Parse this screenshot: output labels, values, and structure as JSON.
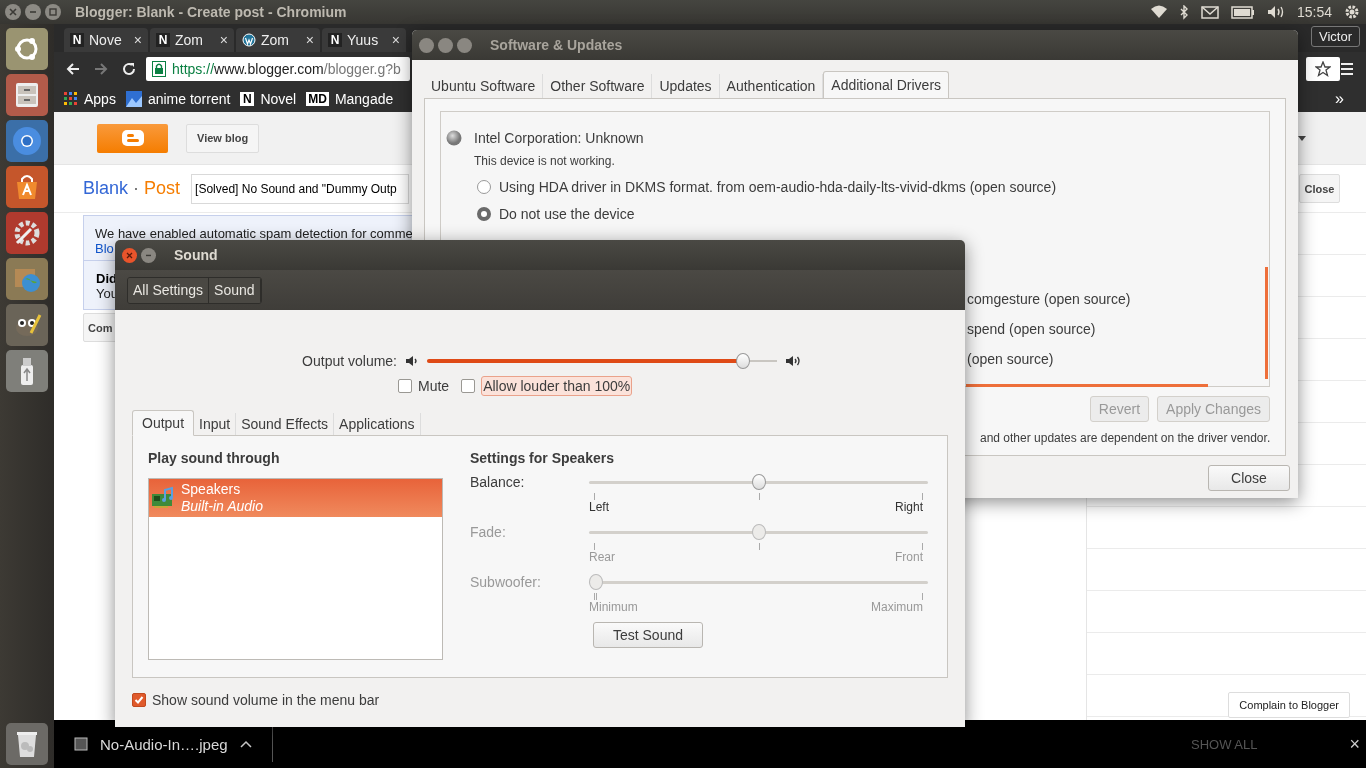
{
  "top_panel": {
    "title": "Blogger: Blank - Create post - Chromium",
    "time": "15:54"
  },
  "browser": {
    "tabs": [
      {
        "kind": "letter",
        "glyph": "N",
        "label": "Nove",
        "selected": false
      },
      {
        "kind": "letter",
        "glyph": "N",
        "label": "Zom",
        "selected": false
      },
      {
        "kind": "wordpress",
        "label": "Zom",
        "selected": false
      },
      {
        "kind": "letter",
        "glyph": "N",
        "label": "Yuus",
        "selected": false
      }
    ],
    "tab_close": "×",
    "profile": "Victor",
    "url": {
      "scheme": "https://",
      "host": "www.blogger.com",
      "path": "/blogger.g?b"
    },
    "bookmarks": [
      {
        "kind": "apps",
        "label": "Apps"
      },
      {
        "kind": "image",
        "label": "anime torrent"
      },
      {
        "kind": "letter",
        "glyph": "N",
        "label": "Novel"
      },
      {
        "kind": "letter",
        "glyph": "MD",
        "label": "Mangade"
      }
    ],
    "more_bookmarks": "»"
  },
  "blogger": {
    "view_blog": "View blog",
    "blog_name": "Blank",
    "separator": "·",
    "section": "Post",
    "post_title": "[Solved] No Sound and \"Dummy Outp",
    "close": "Close",
    "notice": {
      "text": "We have enabled automatic spam detection for comme",
      "link": "Blo"
    },
    "tip": {
      "heading": "Did",
      "text": "You"
    },
    "comment_button": "Com",
    "complain": "Complain to Blogger"
  },
  "software_updates": {
    "title": "Software & Updates",
    "tabs": [
      {
        "label": "Ubuntu Software",
        "selected": false
      },
      {
        "label": "Other Software",
        "selected": false
      },
      {
        "label": "Updates",
        "selected": false
      },
      {
        "label": "Authentication",
        "selected": false
      },
      {
        "label": "Additional Drivers",
        "selected": true
      }
    ],
    "device": "Intel Corporation: Unknown",
    "device_status": "This device is not working.",
    "options": [
      {
        "label": "Using HDA driver in DKMS format. from oem-audio-hda-daily-lts-vivid-dkms (open source)",
        "selected": false
      },
      {
        "label": "Do not use the device",
        "selected": true
      }
    ],
    "partial_rows": [
      "comgesture (open source)",
      "spend (open source)",
      "(open source)"
    ],
    "revert": "Revert",
    "apply": "Apply Changes",
    "buttons_disabled": true,
    "footer": "and other updates are dependent on the driver vendor.",
    "close": "Close"
  },
  "sound": {
    "title": "Sound",
    "breadcrumb": [
      "All Settings",
      "Sound"
    ],
    "volume": {
      "label": "Output volume:",
      "level": 0.92
    },
    "mute": {
      "label": "Mute",
      "checked": false
    },
    "allow_louder": {
      "label": "Allow louder than 100%",
      "checked": false,
      "focused": true
    },
    "tabs": [
      {
        "label": "Output",
        "selected": true
      },
      {
        "label": "Input",
        "selected": false
      },
      {
        "label": "Sound Effects",
        "selected": false
      },
      {
        "label": "Applications",
        "selected": false
      }
    ],
    "devices_heading": "Play sound through",
    "devices": [
      {
        "name": "Speakers",
        "detail": "Built-in Audio",
        "selected": true
      }
    ],
    "settings_heading": "Settings for Speakers",
    "sliders": [
      {
        "label": "Balance:",
        "level": 0.5,
        "disabled": false,
        "min": "Left",
        "max": "Right"
      },
      {
        "label": "Fade:",
        "level": 0.5,
        "disabled": true,
        "min": "Rear",
        "max": "Front"
      },
      {
        "label": "Subwoofer:",
        "level": 0,
        "disabled": true,
        "min": "Minimum",
        "max": "Maximum"
      }
    ],
    "test_button": "Test Sound",
    "show_in_menu": {
      "label": "Show sound volume in the menu bar",
      "checked": true
    }
  },
  "downloads": {
    "file": "No-Audio-In….jpeg",
    "show_all": "SHOW ALL",
    "close": "×"
  }
}
